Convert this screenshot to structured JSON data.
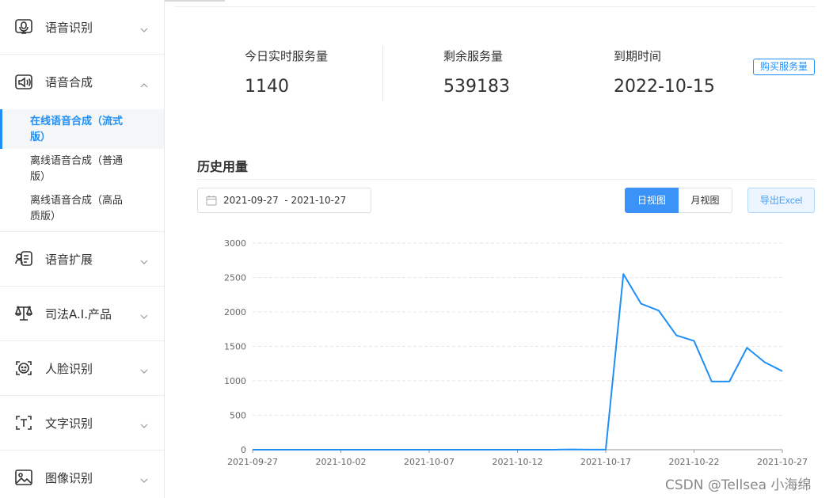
{
  "sidebar": {
    "items": [
      {
        "label": "语音识别",
        "icon": "microphone-icon",
        "expanded": false
      },
      {
        "label": "语音合成",
        "icon": "speaker-icon",
        "expanded": true,
        "children": [
          {
            "label": "在线语音合成（流式版）",
            "active": true
          },
          {
            "label": "离线语音合成（普通版）",
            "active": false
          },
          {
            "label": "离线语音合成（高品质版）",
            "active": false
          }
        ]
      },
      {
        "label": "语音扩展",
        "icon": "voice-extension-icon",
        "expanded": false
      },
      {
        "label": "司法A.I.产品",
        "icon": "scales-icon",
        "expanded": false
      },
      {
        "label": "人脸识别",
        "icon": "face-icon",
        "expanded": false
      },
      {
        "label": "文字识别",
        "icon": "text-icon",
        "expanded": false
      },
      {
        "label": "图像识别",
        "icon": "image-icon",
        "expanded": false
      }
    ]
  },
  "stats": [
    {
      "label": "今日实时服务量",
      "value": "1140"
    },
    {
      "label": "剩余服务量",
      "value": "539183"
    },
    {
      "label": "到期时间",
      "value": "2022-10-15"
    }
  ],
  "buy_button": "购买服务量",
  "history": {
    "title": "历史用量",
    "date_range": "2021-09-27  - 2021-10-27",
    "view_day": "日视图",
    "view_month": "月视图",
    "export": "导出Excel"
  },
  "colors": {
    "accent": "#1f8ff5",
    "line": "#1f8ff5"
  },
  "chart_data": {
    "type": "line",
    "x": [
      "2021-09-27",
      "2021-09-28",
      "2021-09-29",
      "2021-09-30",
      "2021-10-01",
      "2021-10-02",
      "2021-10-03",
      "2021-10-04",
      "2021-10-05",
      "2021-10-06",
      "2021-10-07",
      "2021-10-08",
      "2021-10-09",
      "2021-10-10",
      "2021-10-11",
      "2021-10-12",
      "2021-10-13",
      "2021-10-14",
      "2021-10-15",
      "2021-10-16",
      "2021-10-17",
      "2021-10-18",
      "2021-10-19",
      "2021-10-20",
      "2021-10-21",
      "2021-10-22",
      "2021-10-23",
      "2021-10-24",
      "2021-10-25",
      "2021-10-26",
      "2021-10-27"
    ],
    "values": [
      0,
      0,
      0,
      0,
      0,
      0,
      0,
      0,
      0,
      0,
      0,
      0,
      0,
      0,
      0,
      0,
      0,
      0,
      5,
      2,
      2,
      2550,
      2120,
      2020,
      1660,
      1580,
      990,
      990,
      1480,
      1270,
      1140
    ],
    "x_tick_labels": [
      "2021-09-27",
      "2021-10-02",
      "2021-10-07",
      "2021-10-12",
      "2021-10-17",
      "2021-10-22",
      "2021-10-27"
    ],
    "y_ticks": [
      0,
      500,
      1000,
      1500,
      2000,
      2500,
      3000
    ],
    "ylim": [
      0,
      3000
    ],
    "grid": true
  },
  "watermark": "CSDN @Tellsea 小海绵"
}
